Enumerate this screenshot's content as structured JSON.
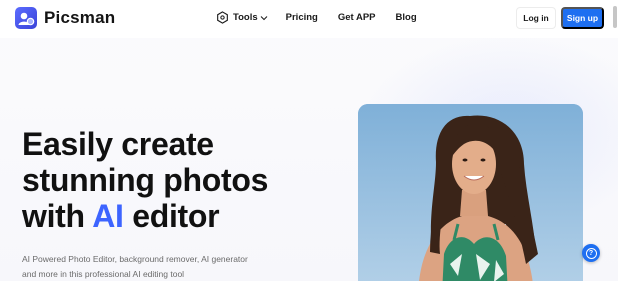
{
  "brand": {
    "name": "Picsman"
  },
  "nav": {
    "tools": "Tools",
    "pricing": "Pricing",
    "get_app": "Get APP",
    "blog": "Blog"
  },
  "auth": {
    "login": "Log in",
    "signup": "Sign up"
  },
  "hero": {
    "title_line1": "Easily create",
    "title_line2": "stunning photos",
    "title_line3_prefix": "with ",
    "title_line3_highlight": "AI",
    "title_line3_suffix": " editor",
    "description_line1": "AI Powered Photo Editor, background remover, AI generator",
    "description_line2": "and more in this professional AI editing tool"
  },
  "help": {
    "glyph": "?"
  },
  "colors": {
    "accent": "#1e6ff1",
    "highlight": "#3d64ff",
    "text": "#111111",
    "muted": "#6b6b6b"
  },
  "icons": {
    "logo": "picsman-logo-icon",
    "tools": "hexagon-tools-icon",
    "chevron": "chevron-down-icon",
    "help": "question-circle-icon"
  }
}
